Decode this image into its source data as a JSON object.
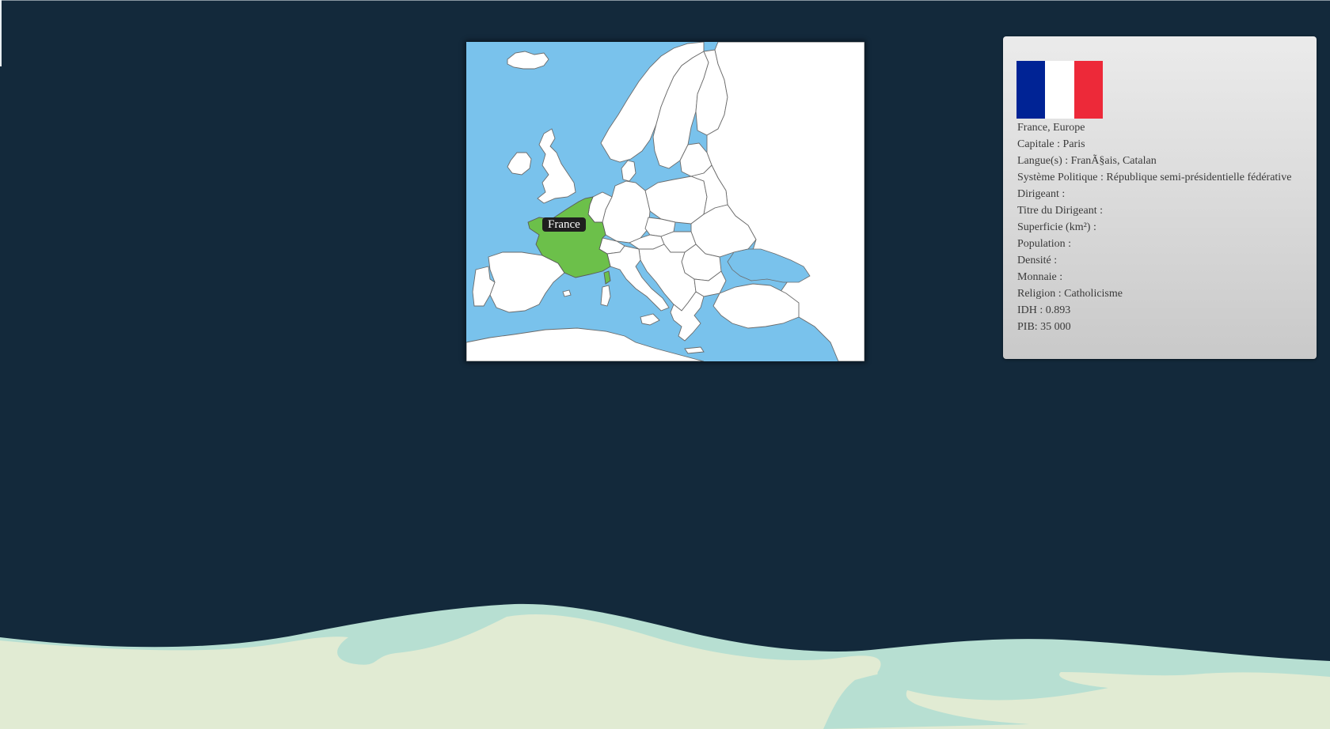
{
  "map": {
    "tooltip": "France",
    "selected_country": "France"
  },
  "colors": {
    "background": "#13293b",
    "sea": "#79c2ec",
    "land": "#ffffff",
    "selected": "#6cc04a",
    "panel": "#dcdcdc",
    "ground_light": "#e1ebd3",
    "ground_water": "#b7dfd2"
  },
  "flag": {
    "icon": "france-flag-icon",
    "colors": [
      "#002395",
      "#ffffff",
      "#ed2939"
    ]
  },
  "info": {
    "location": "France, Europe",
    "capital": "Capitale : Paris",
    "languages": "Langue(s) : FranÃ§ais, Catalan",
    "political_system": "Système Politique : République semi-présidentielle fédérative",
    "leader": "Dirigeant :",
    "leader_title": "Titre du Dirigeant :",
    "area": "Superficie (km²) :",
    "population": "Population :",
    "density": "Densité :",
    "currency": "Monnaie :",
    "religion": "Religion : Catholicisme",
    "hdi": "IDH : 0.893",
    "gdp": "PIB: 35 000"
  }
}
